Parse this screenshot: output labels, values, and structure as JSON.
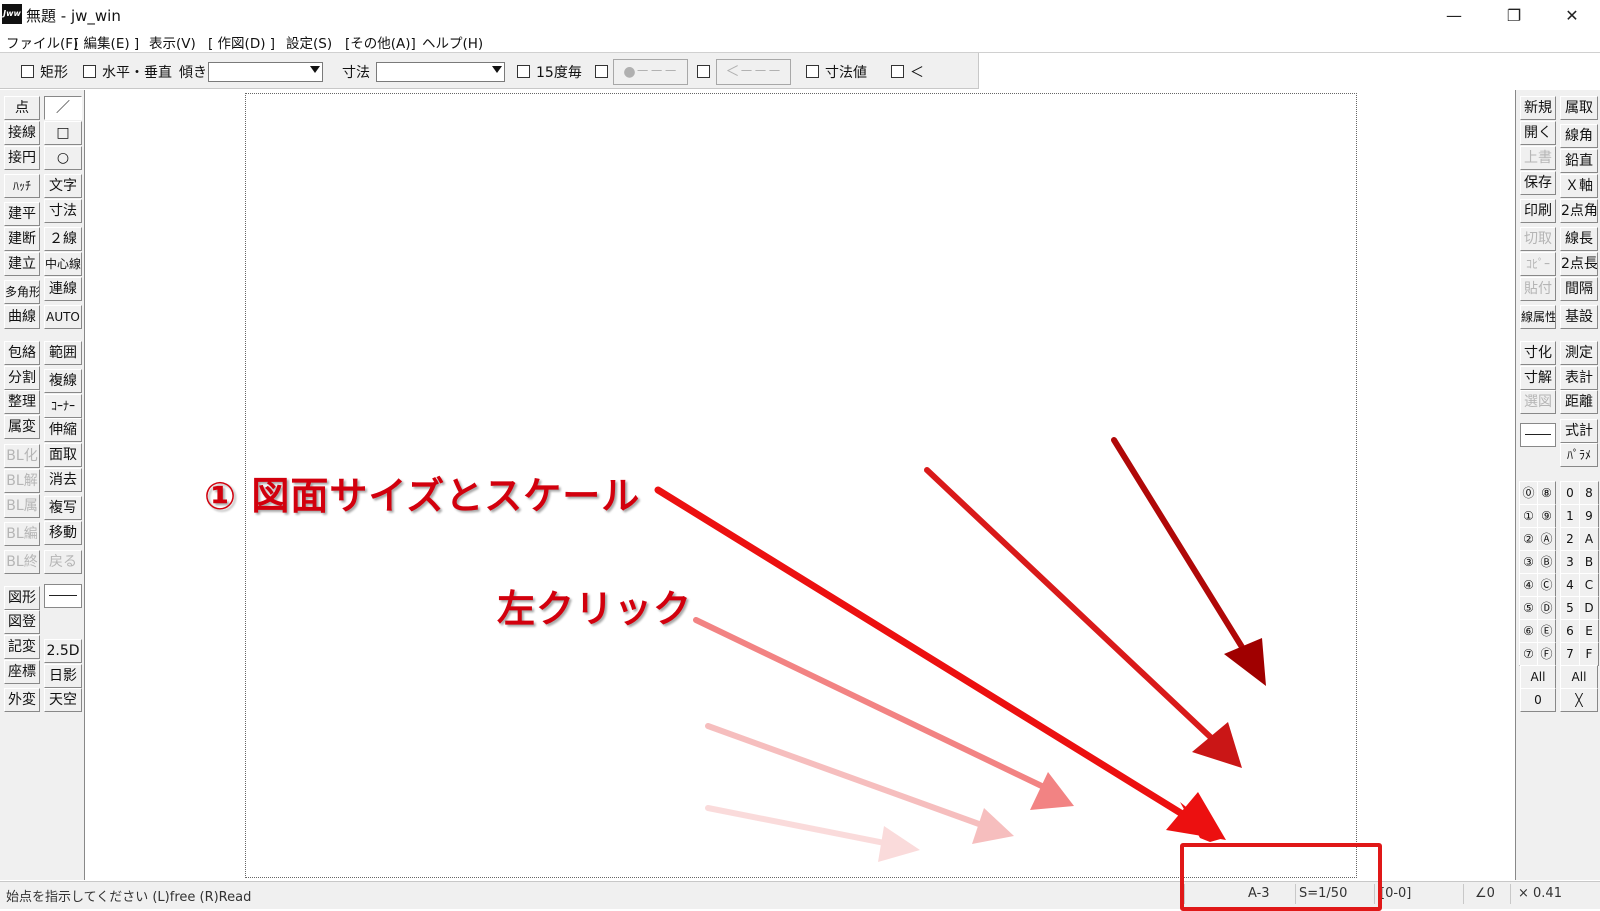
{
  "window": {
    "app_icon_text": "Jww",
    "title": "無題 - jw_win",
    "minimize_icon": "minimize-icon",
    "restore_icon": "restore-icon",
    "close_icon": "close-icon"
  },
  "menu": [
    "ファイル(F)",
    "[ 編集(E) ]",
    "表示(V)",
    "[ 作図(D) ]",
    "設定(S)",
    "[その他(A)]",
    "ヘルプ(H)"
  ],
  "toolbar": {
    "rect_label": "矩形",
    "hv_label": "水平・垂直",
    "tilt_label": "傾き",
    "tilt_value": "",
    "dim_label": "寸法",
    "dim_value": "",
    "deg15_label": "15度毎",
    "dot_button": "●－－－",
    "arrow_button": "＜－－－",
    "dimval_label": "寸法値",
    "lt_label": "＜"
  },
  "left_panel": {
    "col1": [
      "点",
      "接線",
      "接円",
      "ﾊｯﾁ",
      "建平",
      "建断",
      "建立",
      "多角形",
      "曲線",
      "包絡",
      "分割",
      "整理",
      "属変",
      "BL化",
      "BL解",
      "BL属",
      "BL編",
      "BL終",
      "図形",
      "図登",
      "記変",
      "座標",
      "外変"
    ],
    "col2": [
      "／",
      "□",
      "○",
      "文字",
      "寸法",
      "２線",
      "中心線",
      "連線",
      "AUTO",
      "範囲",
      "複線",
      "ｺｰﾅｰ",
      "伸縮",
      "面取",
      "消去",
      "複写",
      "移動",
      "戻る",
      "",
      "",
      "2.5D",
      "日影",
      "天空"
    ]
  },
  "right_panel": {
    "col1": [
      "新規",
      "開く",
      "上書",
      "保存",
      "印刷",
      "切取",
      "ｺﾋﾟｰ",
      "貼付",
      "線属性",
      "寸化",
      "寸解",
      "選図"
    ],
    "col2": [
      "属取",
      "線角",
      "鉛直",
      "Ｘ軸",
      "2点角",
      "線長",
      "2点長",
      "間隔",
      "基設",
      "測定",
      "表計",
      "距離",
      "式計",
      "ﾊﾟﾗﾒ"
    ],
    "layer_groups": [
      "⓪",
      "①",
      "②",
      "③",
      "④",
      "⑤",
      "⑥",
      "⑦"
    ],
    "layer_groups2": [
      "⑧",
      "⑨",
      "Ⓐ",
      "Ⓑ",
      "Ⓒ",
      "Ⓓ",
      "Ⓔ",
      "Ⓕ"
    ],
    "layers": [
      "0",
      "1",
      "2",
      "3",
      "4",
      "5",
      "6",
      "7"
    ],
    "layers2": [
      "8",
      "9",
      "A",
      "B",
      "C",
      "D",
      "E",
      "F"
    ],
    "all_label": "All",
    "zero_label": "0",
    "x_label": "╳"
  },
  "status": {
    "message": "始点を指示してください (L)free (R)Read",
    "paper_size": "A-3",
    "scale": "S=1/50",
    "layer": "[0-0]",
    "angle": "∠0",
    "zoom": "× 0.41"
  },
  "annotations": {
    "step1": "① 図面サイズとスケール",
    "click": "左クリック"
  },
  "colors": {
    "annotation_red": "#d2000d",
    "highlight_red": "#e01818"
  }
}
